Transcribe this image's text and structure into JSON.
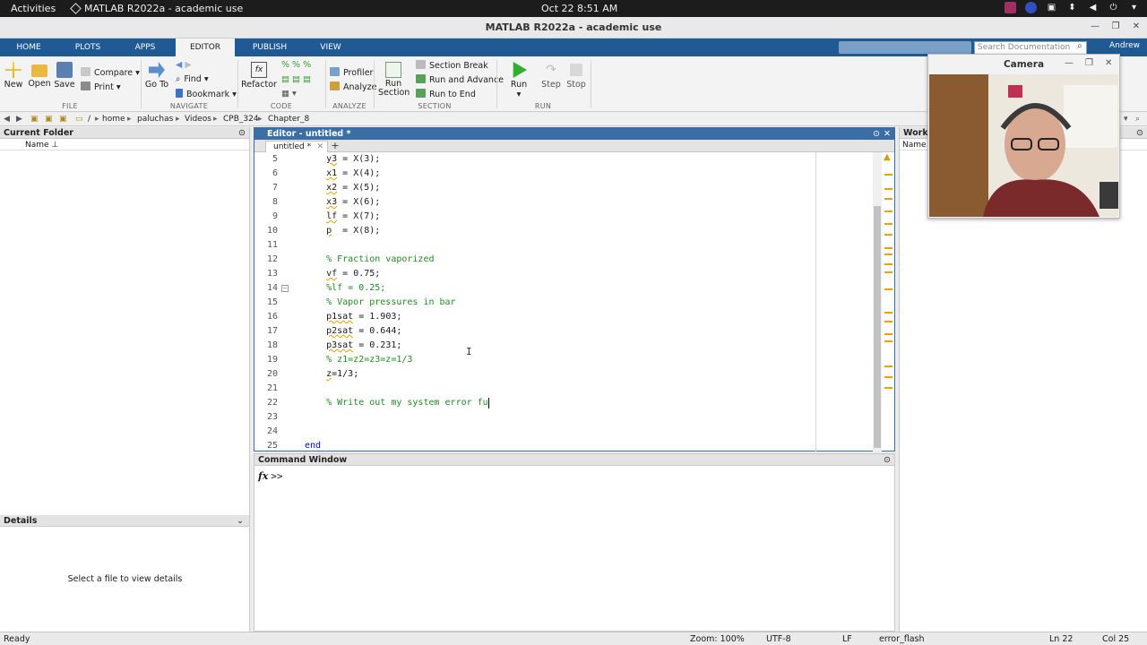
{
  "topbar": {
    "activities": "Activities",
    "app_name": "MATLAB R2022a - academic use",
    "datetime": "Oct 22  8:51 AM"
  },
  "window": {
    "title": "MATLAB R2022a - academic use"
  },
  "ribbon": {
    "tabs": [
      {
        "label": "HOME"
      },
      {
        "label": "PLOTS"
      },
      {
        "label": "APPS"
      },
      {
        "label": "EDITOR"
      },
      {
        "label": "PUBLISH"
      },
      {
        "label": "VIEW"
      }
    ],
    "active_tab": "EDITOR",
    "search_placeholder": "Search Documentation",
    "user": "Andrew"
  },
  "toolstrip": {
    "file": {
      "new": "New",
      "open": "Open",
      "save": "Save",
      "compare": "Compare",
      "print": "Print",
      "label": "FILE"
    },
    "navigate": {
      "go_to": "Go To",
      "find": "Find",
      "bookmark": "Bookmark",
      "label": "NAVIGATE"
    },
    "code": {
      "refactor": "Refactor",
      "label": "CODE"
    },
    "analyze": {
      "profiler": "Profiler",
      "analyze": "Analyze",
      "label": "ANALYZE"
    },
    "section": {
      "run_section": "Run Section",
      "section_break": "Section Break",
      "run_and_advance": "Run and Advance",
      "run_to_end": "Run to End",
      "label": "SECTION"
    },
    "run": {
      "run": "Run",
      "step": "Step",
      "stop": "Stop",
      "label": "RUN"
    }
  },
  "address": {
    "path": [
      "/",
      "home",
      "paluchas",
      "Videos",
      "CPB_324",
      "Chapter_8"
    ]
  },
  "current_folder": {
    "title": "Current Folder",
    "col_name": "Name ⊥"
  },
  "details": {
    "title": "Details",
    "message": "Select a file to view details"
  },
  "editor": {
    "title": "Editor - untitled *",
    "tab": "untitled *",
    "lines": [
      {
        "n": "5",
        "text": "    y3 = X(3);",
        "type": "code"
      },
      {
        "n": "6",
        "text": "    x1 = X(4);",
        "type": "code"
      },
      {
        "n": "7",
        "text": "    x2 = X(5);",
        "type": "code"
      },
      {
        "n": "8",
        "text": "    x3 = X(6);",
        "type": "code"
      },
      {
        "n": "9",
        "text": "    lf = X(7);",
        "type": "code"
      },
      {
        "n": "10",
        "text": "    p  = X(8);",
        "type": "code"
      },
      {
        "n": "11",
        "text": "",
        "type": "code"
      },
      {
        "n": "12",
        "text": "    % Fraction vaporized",
        "type": "comment"
      },
      {
        "n": "13",
        "text": "    vf = 0.75;",
        "type": "code"
      },
      {
        "n": "14",
        "text": "    %lf = 0.25;",
        "type": "comment"
      },
      {
        "n": "15",
        "text": "    % Vapor pressures in bar",
        "type": "comment"
      },
      {
        "n": "16",
        "text": "    p1sat = 1.903;",
        "type": "code"
      },
      {
        "n": "17",
        "text": "    p2sat = 0.644;",
        "type": "code"
      },
      {
        "n": "18",
        "text": "    p3sat = 0.231;",
        "type": "code"
      },
      {
        "n": "19",
        "text": "    % z1=z2=z3=z=1/3",
        "type": "comment"
      },
      {
        "n": "20",
        "text": "    z=1/3;",
        "type": "code"
      },
      {
        "n": "21",
        "text": "",
        "type": "code"
      },
      {
        "n": "22",
        "text": "    % Write out my system error fu",
        "type": "comment"
      },
      {
        "n": "23",
        "text": "",
        "type": "code"
      },
      {
        "n": "24",
        "text": "",
        "type": "code"
      },
      {
        "n": "25",
        "text": "end",
        "type": "keyword"
      }
    ]
  },
  "command_window": {
    "title": "Command Window",
    "fx": "fx",
    "prompt": ">>"
  },
  "workspace": {
    "title": "Workspace",
    "col_name": "Name"
  },
  "camera": {
    "title": "Camera"
  },
  "status": {
    "ready": "Ready",
    "zoom": "Zoom: 100%",
    "encoding": "UTF-8",
    "eol": "LF",
    "function": "error_flash",
    "line": "Ln  22",
    "col": "Col  25"
  },
  "colors": {
    "ribbon_tab_bar": "#1f5a95",
    "editor_header": "#3c6ea3",
    "comment": "#228b22",
    "keyword": "#0000ff"
  }
}
